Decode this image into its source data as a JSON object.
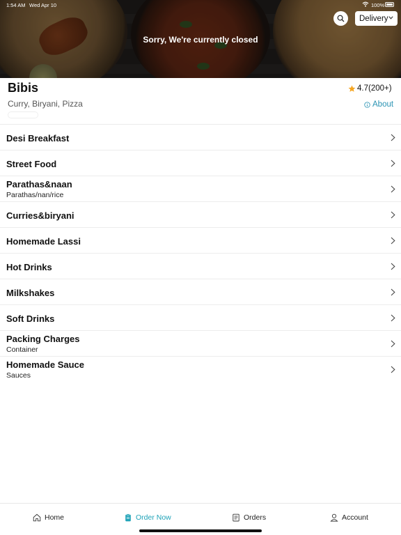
{
  "status_bar": {
    "time": "1:54 AM",
    "date": "Wed Apr 10",
    "battery": "100%"
  },
  "hero": {
    "closed_message": "Sorry, We're currently closed"
  },
  "header": {
    "order_mode": "Delivery"
  },
  "restaurant": {
    "name": "Bibis",
    "cuisines": "Curry, Biryani, Pizza",
    "rating": "4.7(200+)",
    "about_label": "About"
  },
  "categories": [
    {
      "title": "Desi Breakfast",
      "subtitle": ""
    },
    {
      "title": "Street Food",
      "subtitle": ""
    },
    {
      "title": "Parathas&naan",
      "subtitle": "Parathas/nan/rice"
    },
    {
      "title": "Curries&biryani",
      "subtitle": ""
    },
    {
      "title": "Homemade Lassi",
      "subtitle": ""
    },
    {
      "title": "Hot Drinks",
      "subtitle": ""
    },
    {
      "title": "Milkshakes",
      "subtitle": ""
    },
    {
      "title": "Soft Drinks",
      "subtitle": ""
    },
    {
      "title": "Packing Charges",
      "subtitle": "Container"
    },
    {
      "title": "Homemade Sauce",
      "subtitle": "Sauces"
    }
  ],
  "tabbar": {
    "home": "Home",
    "order_now": "Order Now",
    "orders": "Orders",
    "account": "Account"
  },
  "colors": {
    "accent": "#1fa3b8",
    "link": "#2a93b3",
    "star": "#f5a623"
  },
  "icons": {
    "search": "search-icon",
    "delivery_chevron": "chevron-down-icon",
    "rating": "star-icon",
    "about": "info-icon",
    "row_chevron": "chevron-right-icon",
    "home": "home-icon",
    "order_now": "clipboard-icon",
    "orders": "receipt-icon",
    "account": "user-icon"
  }
}
